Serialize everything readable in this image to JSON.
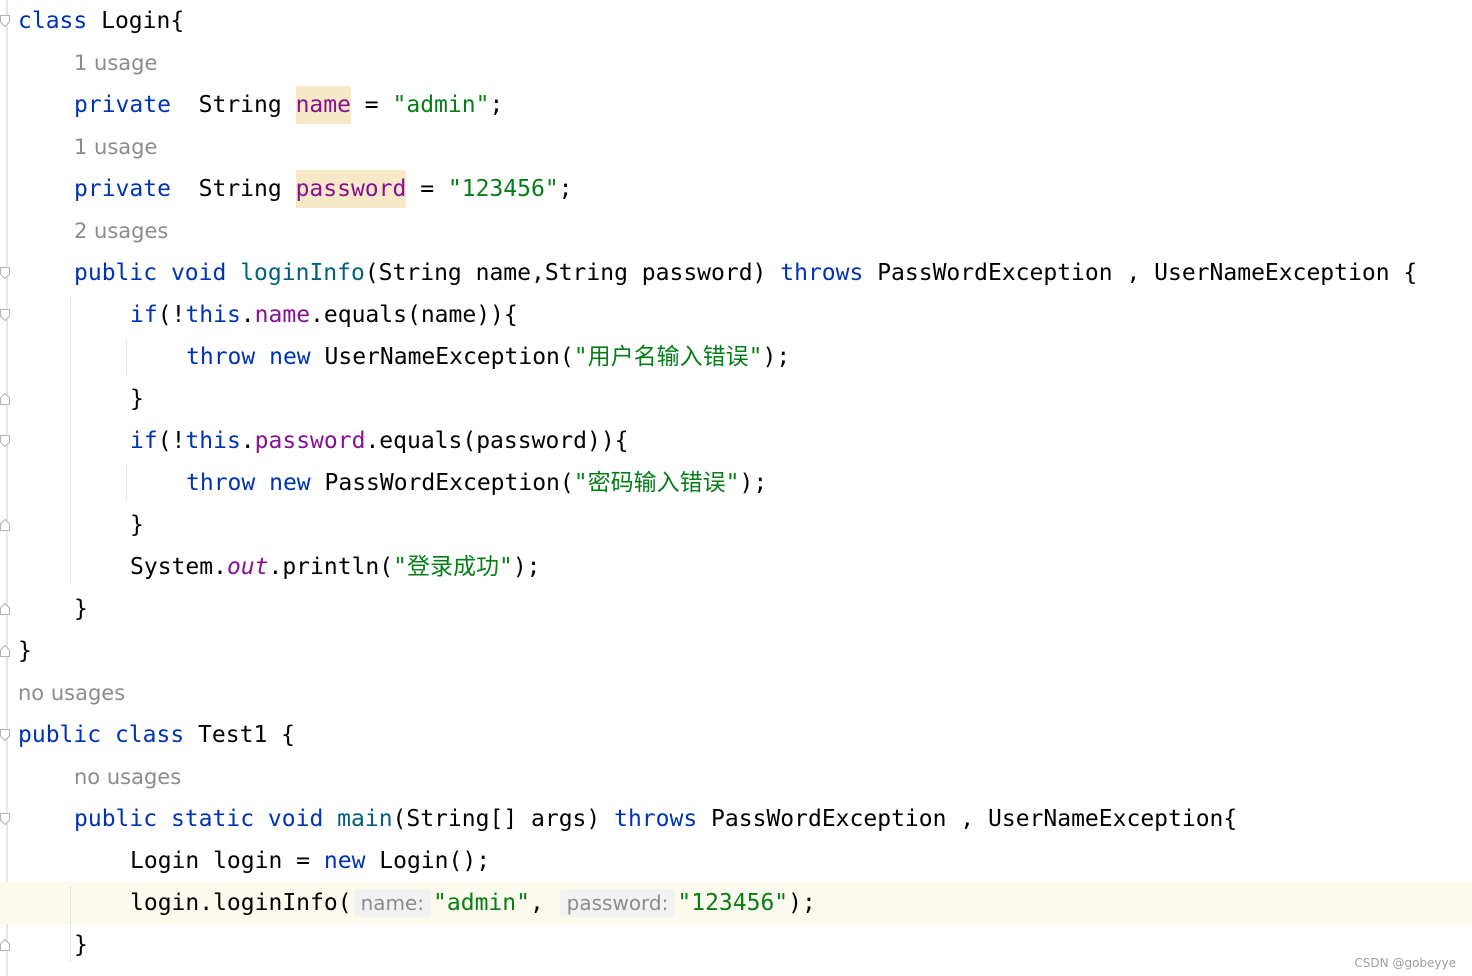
{
  "lines": [
    {
      "type": "code",
      "tokens": [
        {
          "t": "class",
          "c": "kw"
        },
        {
          "t": " Login{"
        }
      ]
    },
    {
      "type": "hint",
      "text": "1 usage"
    },
    {
      "type": "code",
      "tokens": [
        {
          "t": "private",
          "c": "kw"
        },
        {
          "t": "  String "
        },
        {
          "t": "name",
          "c": "field hl"
        },
        {
          "t": " = "
        },
        {
          "t": "\"admin\"",
          "c": "str"
        },
        {
          "t": ";"
        }
      ]
    },
    {
      "type": "hint",
      "text": "1 usage"
    },
    {
      "type": "code",
      "tokens": [
        {
          "t": "private",
          "c": "kw"
        },
        {
          "t": "  String "
        },
        {
          "t": "password",
          "c": "field hl"
        },
        {
          "t": " = "
        },
        {
          "t": "\"123456\"",
          "c": "str"
        },
        {
          "t": ";"
        }
      ]
    },
    {
      "type": "hint",
      "text": "2 usages"
    },
    {
      "type": "code",
      "tokens": [
        {
          "t": "public",
          "c": "kw"
        },
        {
          "t": " "
        },
        {
          "t": "void",
          "c": "kw"
        },
        {
          "t": " "
        },
        {
          "t": "loginInfo",
          "c": "method"
        },
        {
          "t": "(String name,String password) "
        },
        {
          "t": "throws",
          "c": "kw"
        },
        {
          "t": " PassWordException , UserNameException {"
        }
      ]
    },
    {
      "type": "code",
      "tokens": [
        {
          "t": "if",
          "c": "kw"
        },
        {
          "t": "(!"
        },
        {
          "t": "this",
          "c": "kw"
        },
        {
          "t": "."
        },
        {
          "t": "name",
          "c": "field"
        },
        {
          "t": ".equals(name)){"
        }
      ]
    },
    {
      "type": "code",
      "tokens": [
        {
          "t": "throw",
          "c": "kw"
        },
        {
          "t": " "
        },
        {
          "t": "new",
          "c": "kw"
        },
        {
          "t": " UserNameException("
        },
        {
          "t": "\"用户名输入错误\"",
          "c": "str"
        },
        {
          "t": ");"
        }
      ]
    },
    {
      "type": "code",
      "tokens": [
        {
          "t": "}"
        }
      ]
    },
    {
      "type": "code",
      "tokens": [
        {
          "t": "if",
          "c": "kw"
        },
        {
          "t": "(!"
        },
        {
          "t": "this",
          "c": "kw"
        },
        {
          "t": "."
        },
        {
          "t": "password",
          "c": "field"
        },
        {
          "t": ".equals(password)){"
        }
      ]
    },
    {
      "type": "code",
      "tokens": [
        {
          "t": "throw",
          "c": "kw"
        },
        {
          "t": " "
        },
        {
          "t": "new",
          "c": "kw"
        },
        {
          "t": " PassWordException("
        },
        {
          "t": "\"密码输入错误\"",
          "c": "str"
        },
        {
          "t": ");"
        }
      ]
    },
    {
      "type": "code",
      "tokens": [
        {
          "t": "}"
        }
      ]
    },
    {
      "type": "code",
      "tokens": [
        {
          "t": "System."
        },
        {
          "t": "out",
          "c": "static"
        },
        {
          "t": ".println("
        },
        {
          "t": "\"登录成功\"",
          "c": "str"
        },
        {
          "t": ");"
        }
      ]
    },
    {
      "type": "code",
      "tokens": [
        {
          "t": "}"
        }
      ]
    },
    {
      "type": "code",
      "tokens": [
        {
          "t": "}"
        }
      ]
    },
    {
      "type": "hint",
      "text": "no usages"
    },
    {
      "type": "code",
      "tokens": [
        {
          "t": "public",
          "c": "kw"
        },
        {
          "t": " "
        },
        {
          "t": "class",
          "c": "kw"
        },
        {
          "t": " Test1 {"
        }
      ]
    },
    {
      "type": "hint",
      "text": "no usages"
    },
    {
      "type": "code",
      "tokens": [
        {
          "t": "public",
          "c": "kw"
        },
        {
          "t": " "
        },
        {
          "t": "static",
          "c": "kw"
        },
        {
          "t": " "
        },
        {
          "t": "void",
          "c": "kw"
        },
        {
          "t": " "
        },
        {
          "t": "main",
          "c": "method"
        },
        {
          "t": "(String[] args) "
        },
        {
          "t": "throws",
          "c": "kw"
        },
        {
          "t": " PassWordException , UserNameException{"
        }
      ]
    },
    {
      "type": "code",
      "tokens": [
        {
          "t": "Login login = "
        },
        {
          "t": "new",
          "c": "kw"
        },
        {
          "t": " Login();"
        }
      ]
    },
    {
      "type": "code",
      "current": true,
      "tokens": [
        {
          "t": "login.loginInfo("
        },
        {
          "t": "name:",
          "c": "inlay"
        },
        {
          "t": "\"admin\"",
          "c": "str"
        },
        {
          "t": ", "
        },
        {
          "t": "password:",
          "c": "inlay"
        },
        {
          "t": "\"123456\"",
          "c": "str"
        },
        {
          "t": ");"
        }
      ]
    },
    {
      "type": "code",
      "tokens": [
        {
          "t": "}"
        }
      ]
    }
  ],
  "watermark": "CSDN @gobeyye"
}
